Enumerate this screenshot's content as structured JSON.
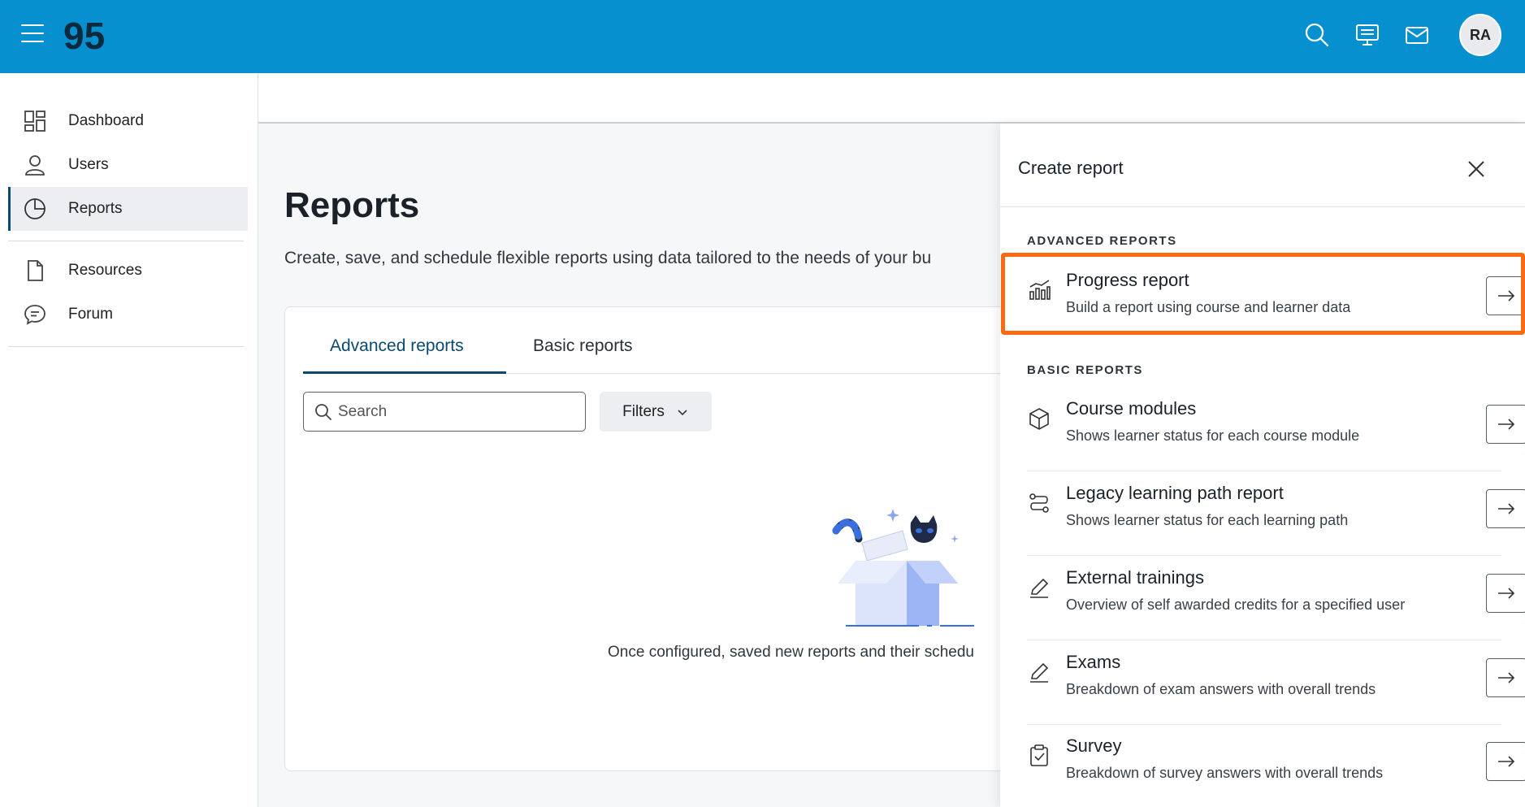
{
  "topbar": {
    "logo_text": "95",
    "avatar_initials": "RA",
    "icons": [
      "menu-icon",
      "search-icon",
      "presentation-icon",
      "mail-icon"
    ]
  },
  "sidebar": {
    "items": [
      {
        "label": "Dashboard",
        "icon": "dashboard-icon"
      },
      {
        "label": "Users",
        "icon": "user-icon"
      },
      {
        "label": "Reports",
        "icon": "pie-chart-icon",
        "active": true
      },
      {
        "label": "Resources",
        "icon": "file-icon"
      },
      {
        "label": "Forum",
        "icon": "chat-icon"
      }
    ]
  },
  "main": {
    "title": "Reports",
    "description": "Create, save, and schedule flexible reports using data tailored to the needs of your bu",
    "tabs": [
      {
        "label": "Advanced reports",
        "active": true
      },
      {
        "label": "Basic reports"
      }
    ],
    "search": {
      "placeholder": "Search",
      "value": ""
    },
    "filters_label": "Filters",
    "empty_text": "Once configured, saved new reports and their schedu"
  },
  "drawer": {
    "title": "Create report",
    "advanced_label": "ADVANCED REPORTS",
    "basic_label": "BASIC REPORTS",
    "advanced": [
      {
        "title": "Progress report",
        "desc": "Build a report using course and learner data",
        "icon": "bar-chart-icon"
      }
    ],
    "basic": [
      {
        "title": "Course modules",
        "desc": "Shows learner status for each course module",
        "icon": "cube-icon"
      },
      {
        "title": "Legacy learning path report",
        "desc": "Shows learner status for each learning path",
        "icon": "route-icon"
      },
      {
        "title": "External trainings",
        "desc": "Overview of self awarded credits for a specified user",
        "icon": "pencil-icon"
      },
      {
        "title": "Exams",
        "desc": "Breakdown of exam answers with overall trends",
        "icon": "pencil-icon"
      },
      {
        "title": "Survey",
        "desc": "Breakdown of survey answers with overall trends",
        "icon": "clipboard-check-icon"
      }
    ]
  },
  "colors": {
    "topbar": "#0690d0",
    "accent": "#0b4a6f",
    "highlight": "#fb6a12"
  }
}
